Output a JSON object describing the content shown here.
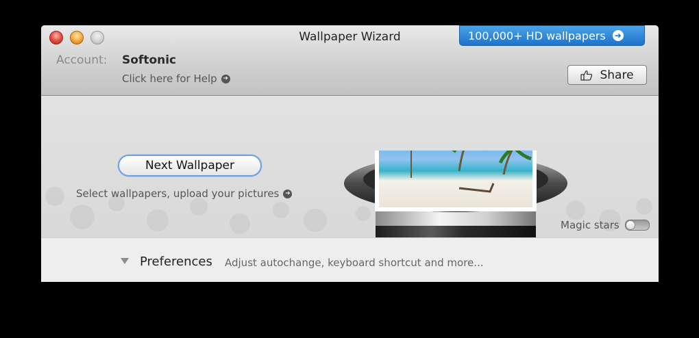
{
  "window": {
    "title": "Wallpaper Wizard",
    "promo_label": "100,000+ HD wallpapers"
  },
  "account": {
    "label": "Account:",
    "name": "Softonic",
    "help_link": "Click here for Help"
  },
  "share": {
    "label": "Share"
  },
  "main": {
    "next_label": "Next Wallpaper",
    "upload_link": "Select wallpapers, upload your pictures",
    "magic_stars_label": "Magic stars",
    "magic_stars_enabled": false
  },
  "preferences": {
    "label": "Preferences",
    "description": "Adjust autochange, keyboard shortcut and more..."
  },
  "colors": {
    "accent_blue": "#1e73c9",
    "close": "#e0463a",
    "minimize": "#f0a73a"
  },
  "icons": [
    "close-icon",
    "minimize-icon",
    "zoom-icon",
    "arrow-right-circle-icon",
    "thumbs-up-icon",
    "disclosure-triangle-icon",
    "magic-hat-icon"
  ]
}
